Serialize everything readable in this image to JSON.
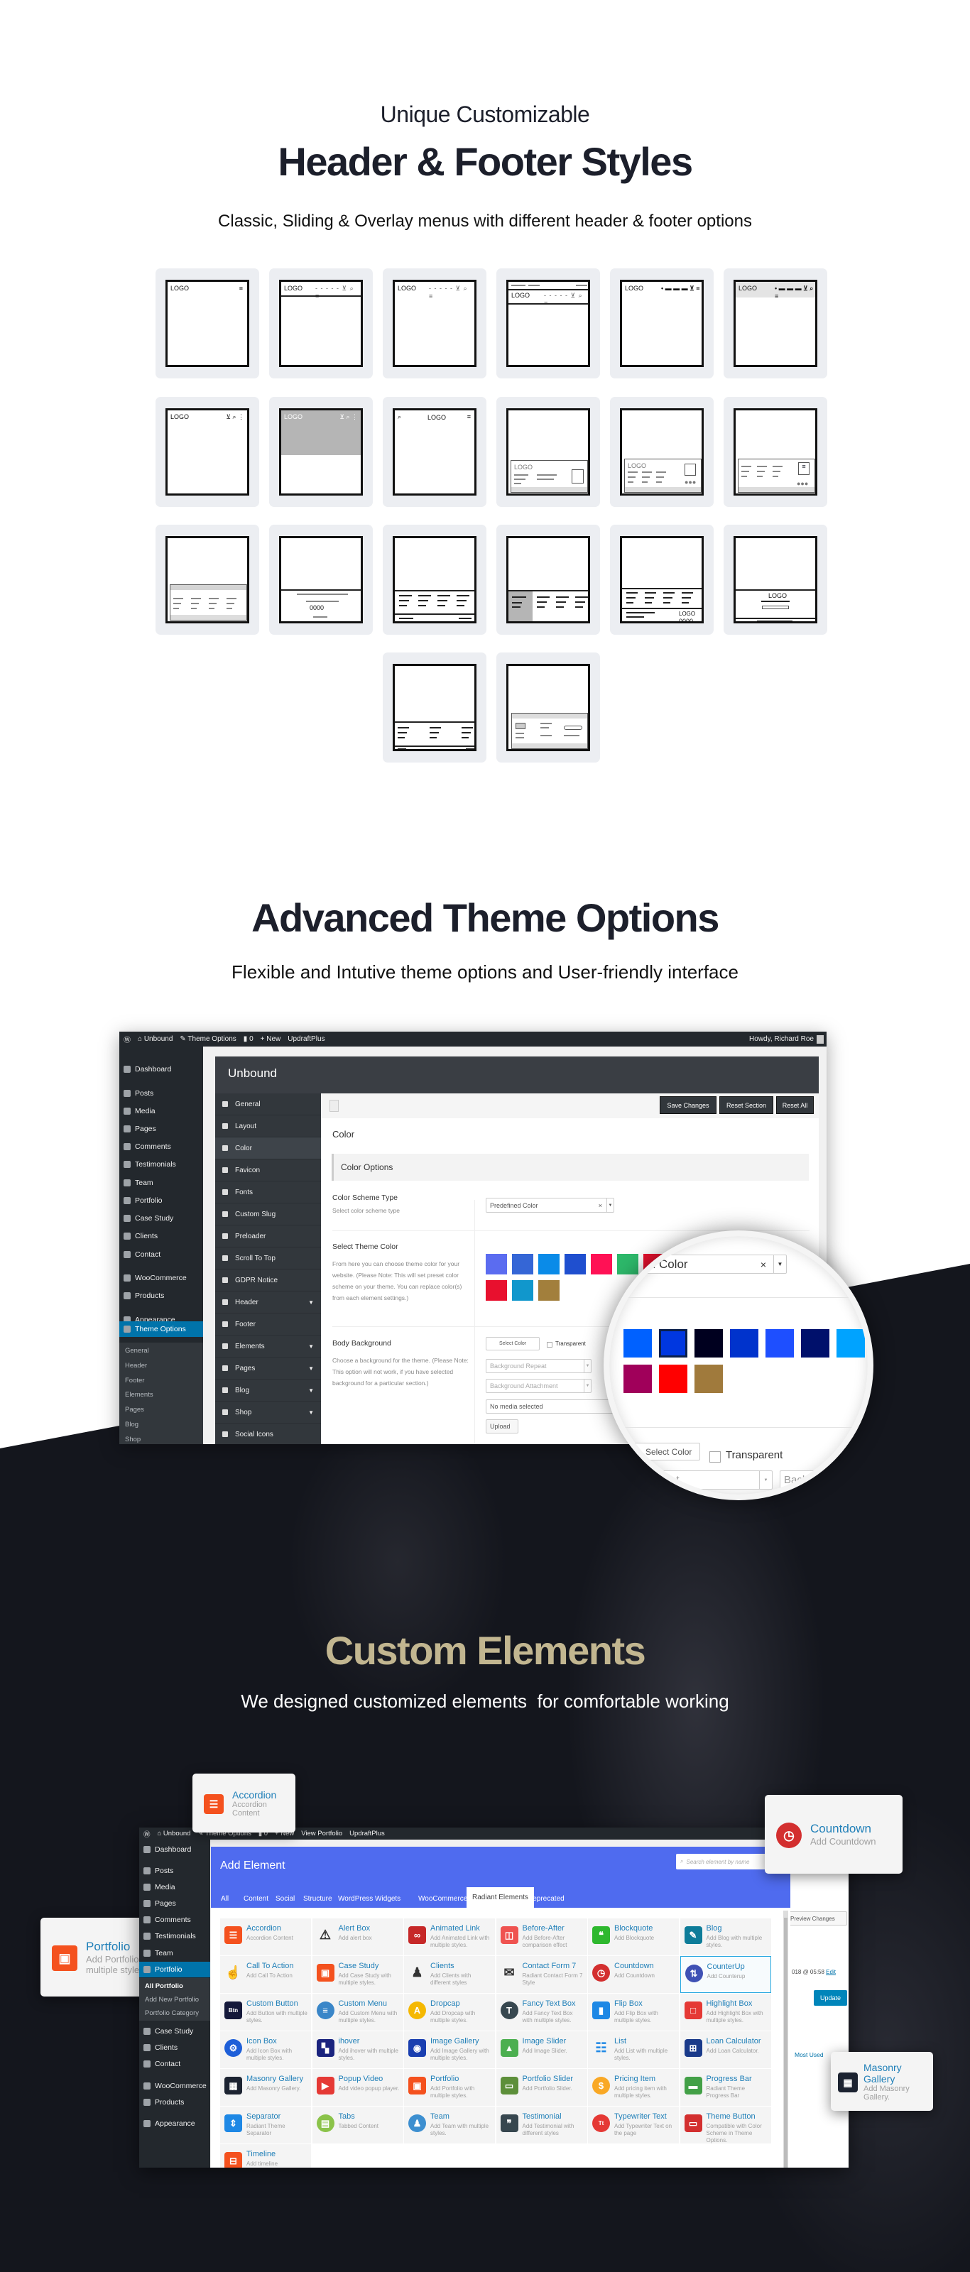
{
  "section_header_footer": {
    "kicker": "Unique Customizable",
    "title": "Header & Footer Styles",
    "subtitle": "Classic, Sliding & Overlay menus with different header & footer options",
    "thumbs": [
      {
        "variant": "h-logo-burger",
        "logo": "LOGO"
      },
      {
        "variant": "h-logo-menu-bordered",
        "logo": "LOGO"
      },
      {
        "variant": "h-logo-menu",
        "logo": "LOGO"
      },
      {
        "variant": "h-topbar",
        "logo": "LOGO"
      },
      {
        "variant": "h-logo-bold-menu",
        "logo": "LOGO"
      },
      {
        "variant": "h-shaded",
        "logo": "LOGO"
      },
      {
        "variant": "h-logo-icons",
        "logo": "LOGO"
      },
      {
        "variant": "h-overlay",
        "logo": "LOGO"
      },
      {
        "variant": "h-centered",
        "logo": "LOGO"
      },
      {
        "variant": "f-logo-box",
        "logo": "LOGO"
      },
      {
        "variant": "f-logo-dots",
        "logo": "LOGO"
      },
      {
        "variant": "f-doc"
      },
      {
        "variant": "f-shaded-cols"
      },
      {
        "variant": "f-centered-dots",
        "dots": "0000"
      },
      {
        "variant": "f-four-cols"
      },
      {
        "variant": "f-sidebar"
      },
      {
        "variant": "f-cols-logo",
        "logo": "LOGO",
        "dots": "0000"
      },
      {
        "variant": "f-center-logo",
        "logo": "LOGO"
      },
      {
        "variant": "f-three-cols"
      },
      {
        "variant": "f-boxed"
      }
    ]
  },
  "section_theme_options": {
    "title": "Advanced Theme Options",
    "subtitle": "Flexible and Intutive theme options and User-friendly interface",
    "adminbar": {
      "site": "Unbound",
      "theme_options": "Theme Options",
      "comments": "0",
      "new": "New",
      "plugin": "UpdraftPlus",
      "greeting": "Howdy, Richard Roe"
    },
    "sidebar": [
      {
        "label": "Dashboard"
      },
      {
        "label": "Posts"
      },
      {
        "label": "Media"
      },
      {
        "label": "Pages"
      },
      {
        "label": "Comments"
      },
      {
        "label": "Testimonials"
      },
      {
        "label": "Team"
      },
      {
        "label": "Portfolio"
      },
      {
        "label": "Case Study"
      },
      {
        "label": "Clients"
      },
      {
        "label": "Contact"
      },
      {
        "label": "WooCommerce"
      },
      {
        "label": "Products"
      },
      {
        "label": "Appearance"
      },
      {
        "label": "Theme Options",
        "active": true
      },
      {
        "label": "General",
        "sub": true
      },
      {
        "label": "Header",
        "sub": true
      },
      {
        "label": "Footer",
        "sub": true
      },
      {
        "label": "Elements",
        "sub": true
      },
      {
        "label": "Pages",
        "sub": true
      },
      {
        "label": "Blog",
        "sub": true
      },
      {
        "label": "Shop",
        "sub": true
      }
    ],
    "panel_title": "Unbound",
    "menu": [
      {
        "label": "General"
      },
      {
        "label": "Layout"
      },
      {
        "label": "Color",
        "active": true
      },
      {
        "label": "Favicon"
      },
      {
        "label": "Fonts"
      },
      {
        "label": "Custom Slug"
      },
      {
        "label": "Preloader"
      },
      {
        "label": "Scroll To Top"
      },
      {
        "label": "GDPR Notice"
      },
      {
        "label": "Header",
        "expand": true
      },
      {
        "label": "Footer"
      },
      {
        "label": "Elements",
        "expand": true
      },
      {
        "label": "Pages",
        "expand": true
      },
      {
        "label": "Blog",
        "expand": true
      },
      {
        "label": "Shop",
        "expand": true
      },
      {
        "label": "Social Icons"
      }
    ],
    "buttons": {
      "save": "Save Changes",
      "reset_section": "Reset Section",
      "reset_all": "Reset All"
    },
    "section_title": "Color",
    "group_title": "Color Options",
    "scheme": {
      "label": "Color Scheme Type",
      "desc": "Select color scheme type",
      "value": "Predefined Color",
      "clear": "×"
    },
    "theme_color": {
      "label": "Select Theme Color",
      "desc": "From here you can choose theme color for your website. (Please Note: This will set preset color scheme on your theme. You can replace color(s) from each element settings.)",
      "swatches": [
        "#5b6cf0",
        "#3566d6",
        "#0a8be8",
        "#1f4fcf",
        "#ff1155",
        "#2db86a",
        "#e8102e",
        "#e8102e",
        "#1197cc",
        "#a27f3c"
      ]
    },
    "body_bg": {
      "label": "Body Background",
      "desc": "Choose a background for the theme. (Please Note: This option will not work, if you have selected background for a particular section.)",
      "select_color": "Select Color",
      "transparent": "Transparent",
      "repeat": "Background Repeat",
      "attachment": "Background Attachment",
      "media": "No media selected",
      "upload": "Upload"
    },
    "magnifier": {
      "value": "Predefined Color",
      "clear": "×",
      "swatches": [
        "#0061ff",
        "#0037e0",
        "#00001f",
        "#0033cc",
        "#1e4fff",
        "#00106b",
        "#00a3ff",
        "#a0005a",
        "#ff0000",
        "#a07a3c"
      ],
      "selected_index": 1,
      "select_color": "Select Color",
      "transparent": "Transparent",
      "repeat": "Background Repeat",
      "attachment": "Background Attachment"
    }
  },
  "section_elements": {
    "title": "Custom Elements",
    "subtitle": "We designed customized elements  for comfortable working",
    "title_color": "#c2b690",
    "adminbar": {
      "site": "Unbound",
      "theme_options": "Theme Options",
      "comments": "0",
      "new": "New",
      "view": "View Portfolio",
      "plugin": "UpdraftPlus"
    },
    "sidebar": [
      {
        "label": "Dashboard"
      },
      {
        "label": "Posts"
      },
      {
        "label": "Media"
      },
      {
        "label": "Pages"
      },
      {
        "label": "Comments"
      },
      {
        "label": "Testimonials"
      },
      {
        "label": "Team"
      },
      {
        "label": "Portfolio",
        "active": true
      },
      {
        "label": "All Portfolio",
        "sub": true,
        "current": true
      },
      {
        "label": "Add New Portfolio",
        "sub": true
      },
      {
        "label": "Portfolio Category",
        "sub": true
      },
      {
        "label": "Case Study"
      },
      {
        "label": "Clients"
      },
      {
        "label": "Contact"
      },
      {
        "label": "WooCommerce"
      },
      {
        "label": "Products"
      },
      {
        "label": "Appearance"
      }
    ],
    "panel_title": "Add Element",
    "search_placeholder": "Search element by name",
    "tabs": [
      {
        "label": "All"
      },
      {
        "label": "Content"
      },
      {
        "label": "Social"
      },
      {
        "label": "Structure"
      },
      {
        "label": "WordPress Widgets"
      },
      {
        "label": "WooCommerce"
      },
      {
        "label": "Radiant Elements",
        "active": true
      },
      {
        "label": "Deprecated"
      }
    ],
    "elements": [
      {
        "title": "Accordion",
        "desc": "Accordion Content",
        "icon": "accordion-icon",
        "glyph": "☰",
        "color": "#f4511e",
        "shape": "square"
      },
      {
        "title": "Alert Box",
        "desc": "Add alert box",
        "icon": "alert-icon",
        "glyph": "⚠",
        "color": "#333",
        "shape": "plain"
      },
      {
        "title": "Animated Link",
        "desc": "Add Animated Link with multiple styles.",
        "icon": "link-icon",
        "glyph": "∞",
        "color": "#c62828",
        "shape": "square"
      },
      {
        "title": "Before-After",
        "desc": "Add Before-After comparison effect",
        "icon": "before-after-icon",
        "glyph": "◫",
        "color": "#ef5350",
        "shape": "square"
      },
      {
        "title": "Blockquote",
        "desc": "Add Blockquote",
        "icon": "quote-icon",
        "glyph": "❝",
        "color": "#2eb82e",
        "shape": "square"
      },
      {
        "title": "Blog",
        "desc": "Add Blog with multiple styles.",
        "icon": "blog-icon",
        "glyph": "✎",
        "color": "#0e7c99",
        "shape": "square"
      },
      {
        "title": "Call To Action",
        "desc": "Add Call To Action",
        "icon": "hand-pointer-icon",
        "glyph": "☝",
        "color": "#888",
        "shape": "plain"
      },
      {
        "title": "Case Study",
        "desc": "Add Case Study with multiple styles.",
        "icon": "image-icon",
        "glyph": "▣",
        "color": "#f4511e",
        "shape": "square"
      },
      {
        "title": "Clients",
        "desc": "Add Clients with different styles",
        "icon": "clients-icon",
        "glyph": "♟",
        "color": "#333",
        "shape": "plain"
      },
      {
        "title": "Contact Form 7",
        "desc": "Radiant Contact Form 7 Style",
        "icon": "envelope-icon",
        "glyph": "✉",
        "color": "#333",
        "shape": "plain"
      },
      {
        "title": "Countdown",
        "desc": "Add Countdown",
        "icon": "stopwatch-icon",
        "glyph": "◷",
        "color": "#d32f2f",
        "shape": "circle"
      },
      {
        "title": "CounterUp",
        "desc": "Add Counterup",
        "icon": "counter-icon",
        "glyph": "⇅",
        "color": "#3f51b5",
        "shape": "circle",
        "highlight": true
      },
      {
        "title": "Custom Button",
        "desc": "Add Button with multiple styles.",
        "icon": "button-icon",
        "glyph": "Btn",
        "color": "#14183a",
        "shape": "square"
      },
      {
        "title": "Custom Menu",
        "desc": "Add Custom Menu with multiple styles.",
        "icon": "menu-icon",
        "glyph": "≡",
        "color": "#3a86c8",
        "shape": "circle"
      },
      {
        "title": "Dropcap",
        "desc": "Add Dropcap with multiple styles.",
        "icon": "dropcap-icon",
        "glyph": "A",
        "color": "#f5b800",
        "shape": "circle"
      },
      {
        "title": "Fancy Text Box",
        "desc": "Add Fancy Text Box with multiple styles.",
        "icon": "text-box-icon",
        "glyph": "T",
        "color": "#37474f",
        "shape": "circle"
      },
      {
        "title": "Flip Box",
        "desc": "Add Flip Box with multiple styles.",
        "icon": "flip-box-icon",
        "glyph": "▮",
        "color": "#1e88e5",
        "shape": "square"
      },
      {
        "title": "Highlight Box",
        "desc": "Add Highlight Box with multiple styles.",
        "icon": "highlight-box-icon",
        "glyph": "□",
        "color": "#e53935",
        "shape": "square"
      },
      {
        "title": "Icon Box",
        "desc": "Add Icon Box with multiple styles.",
        "icon": "gears-icon",
        "glyph": "⚙",
        "color": "#1e5fd8",
        "shape": "circle"
      },
      {
        "title": "ihover",
        "desc": "Add ihover with multiple styles.",
        "icon": "ihover-icon",
        "glyph": "▚",
        "color": "#1a237e",
        "shape": "square"
      },
      {
        "title": "Image Gallery",
        "desc": "Add Image Gallery with multiple styles.",
        "icon": "camera-icon",
        "glyph": "◉",
        "color": "#1a3fb0",
        "shape": "square"
      },
      {
        "title": "Image Slider",
        "desc": "Add Image Slider.",
        "icon": "image-slider-icon",
        "glyph": "▲",
        "color": "#4caf50",
        "shape": "square"
      },
      {
        "title": "List",
        "desc": "Add List with multiple styles.",
        "icon": "list-icon",
        "glyph": "☷",
        "color": "#1e88e5",
        "shape": "plain"
      },
      {
        "title": "Loan Calculator",
        "desc": "Add Loan Calculator.",
        "icon": "calculator-icon",
        "glyph": "⊞",
        "color": "#1a3a8a",
        "shape": "square"
      },
      {
        "title": "Masonry Gallery",
        "desc": "Add Masonry Gallery.",
        "icon": "masonry-icon",
        "glyph": "▦",
        "color": "#1c2331",
        "shape": "square"
      },
      {
        "title": "Popup Video",
        "desc": "Add video popup player.",
        "icon": "play-icon",
        "glyph": "▶",
        "color": "#e53935",
        "shape": "square"
      },
      {
        "title": "Portfolio",
        "desc": "Add Portfolio with multiple styles.",
        "icon": "portfolio-icon",
        "glyph": "▣",
        "color": "#f4511e",
        "shape": "square"
      },
      {
        "title": "Portfolio Slider",
        "desc": "Add Portfolio Slider.",
        "icon": "portfolio-slider-icon",
        "glyph": "▭",
        "color": "#5d8f3a",
        "shape": "square"
      },
      {
        "title": "Pricing Item",
        "desc": "Add pricing item with multiple styles.",
        "icon": "dollar-icon",
        "glyph": "$",
        "color": "#f9a825",
        "shape": "circle"
      },
      {
        "title": "Progress Bar",
        "desc": "Radiant Theme Progress Bar",
        "icon": "progress-icon",
        "glyph": "▬",
        "color": "#43a047",
        "shape": "square"
      },
      {
        "title": "Separator",
        "desc": "Radiant Theme Separator",
        "icon": "separator-icon",
        "glyph": "⇕",
        "color": "#1e88e5",
        "shape": "square"
      },
      {
        "title": "Tabs",
        "desc": "Tabbed Content",
        "icon": "tabs-icon",
        "glyph": "▤",
        "color": "#8bc34a",
        "shape": "circle"
      },
      {
        "title": "Team",
        "desc": "Add Team with multiple styles.",
        "icon": "team-icon",
        "glyph": "♟",
        "color": "#3d8fd0",
        "shape": "circle"
      },
      {
        "title": "Testimonial",
        "desc": "Add Testimonial with different styles",
        "icon": "testimonial-icon",
        "glyph": "❞",
        "color": "#37474f",
        "shape": "square"
      },
      {
        "title": "Typewriter Text",
        "desc": "Add Typewriter Text on the page",
        "icon": "typewriter-icon",
        "glyph": "Tt",
        "color": "#e53935",
        "shape": "circle"
      },
      {
        "title": "Theme Button",
        "desc": "Compatible with Color Scheme in Theme Options.",
        "icon": "theme-button-icon",
        "glyph": "▭",
        "color": "#d32f2f",
        "shape": "square"
      },
      {
        "title": "Timeline",
        "desc": "Add timeline",
        "icon": "timeline-icon",
        "glyph": "⊟",
        "color": "#f4511e",
        "shape": "square"
      }
    ],
    "editor_side": {
      "preview": "Preview Changes",
      "date": "018 @ 05:58",
      "edit": "Edit",
      "update": "Update",
      "most_used": "Most Used"
    },
    "floating_cards": [
      {
        "title": "Accordion",
        "desc": "Accordion Content",
        "glyph": "☰",
        "color": "#f4511e"
      },
      {
        "title": "Portfolio",
        "desc": "Add Portfolio with multiple styles.",
        "glyph": "▣",
        "color": "#f4511e"
      },
      {
        "title": "Countdown",
        "desc": "Add Countdown",
        "glyph": "◷",
        "color": "#d32f2f"
      },
      {
        "title": "Masonry Gallery",
        "desc": "Add Masonry Gallery.",
        "glyph": "▦",
        "color": "#1c2331"
      }
    ]
  }
}
